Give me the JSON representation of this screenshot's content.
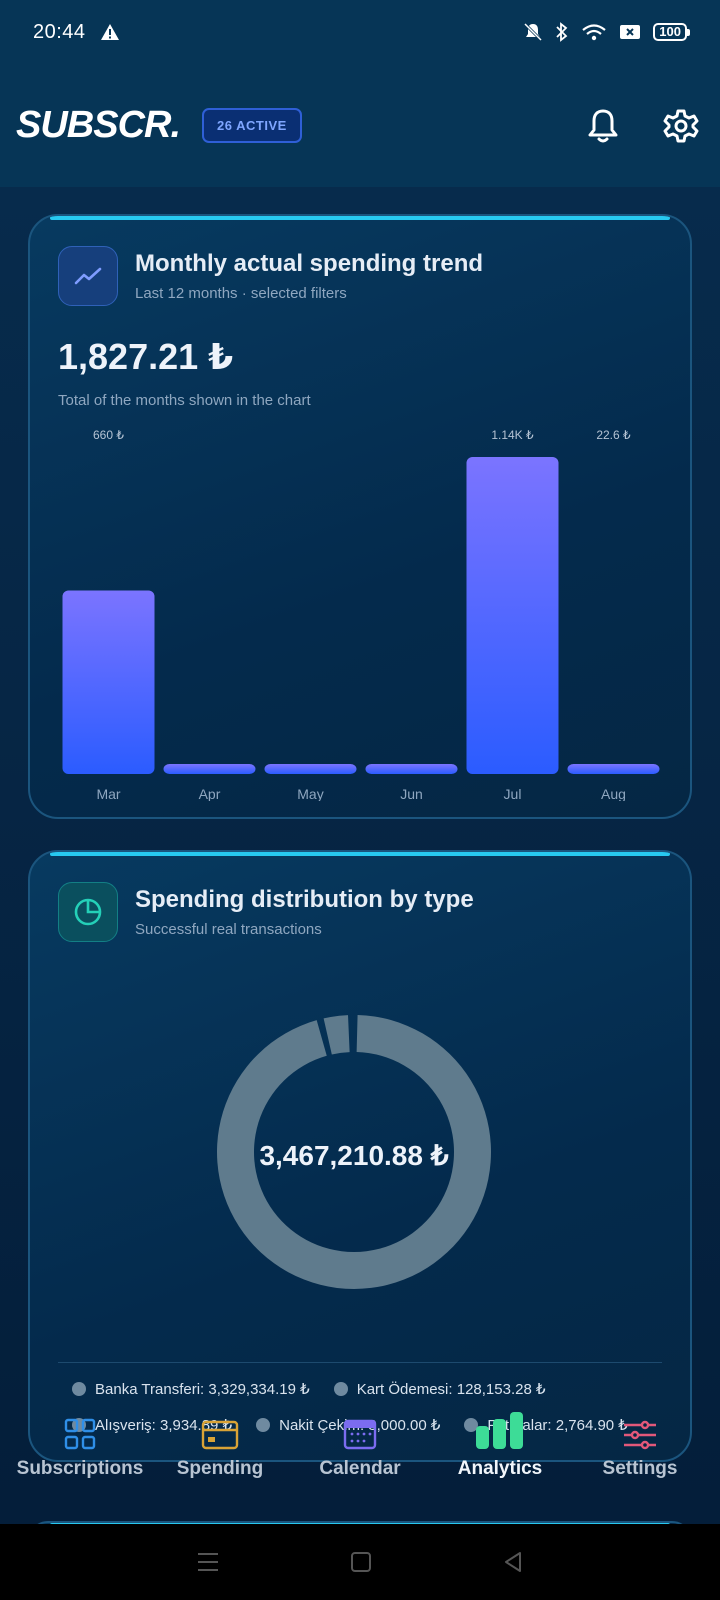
{
  "status_bar": {
    "time": "20:44",
    "battery": "100"
  },
  "header": {
    "logo": "SUBSCR.",
    "active_badge": "26 ACTIVE"
  },
  "trend_card": {
    "title": "Monthly actual spending trend",
    "subtitle": "Last 12 months · selected filters",
    "total": "1,827.21 ₺",
    "total_note": "Total of the months shown in the chart"
  },
  "chart_data": {
    "type": "bar",
    "categories": [
      "Mar",
      "Apr",
      "May",
      "Jun",
      "Jul",
      "Aug"
    ],
    "values": [
      660,
      22,
      22,
      22,
      1140,
      22.6
    ],
    "data_labels": [
      "660 ₺",
      "",
      "",
      "",
      "1.14K ₺",
      "22.6 ₺"
    ],
    "title": "",
    "xlabel": "",
    "ylabel": "",
    "ylim": [
      0,
      1140
    ],
    "grid": false,
    "colors": {
      "top": "#7b74ff",
      "bottom": "#2b5cff"
    }
  },
  "distribution_card": {
    "title": "Spending distribution by type",
    "subtitle": "Successful real transactions",
    "donut_total": "3,467,210.88 ₺",
    "legend": [
      {
        "label": "Banka Transferi: 3,329,334.19 ₺",
        "value": 3329334.19
      },
      {
        "label": "Kart Ödemesi: 128,153.28 ₺",
        "value": 128153.28
      },
      {
        "label": "Alışveriş: 3,934.89 ₺",
        "value": 3934.89
      },
      {
        "label": "Nakit Çekim: 3,000.00 ₺",
        "value": 3000.0
      },
      {
        "label": "Faturalar: 2,764.90 ₺",
        "value": 2764.9
      }
    ]
  },
  "bottom_nav": {
    "items": [
      {
        "label": "Subscriptions",
        "icon": "grid-icon",
        "color": "#2f8fe8"
      },
      {
        "label": "Spending",
        "icon": "card-icon",
        "color": "#d9a336"
      },
      {
        "label": "Calendar",
        "icon": "calendar-icon",
        "color": "#7b6cf0"
      },
      {
        "label": "Analytics",
        "icon": "bar-chart-icon",
        "color": "#3ddc97",
        "active": true
      },
      {
        "label": "Settings",
        "icon": "sliders-icon",
        "color": "#e2587a"
      }
    ]
  }
}
